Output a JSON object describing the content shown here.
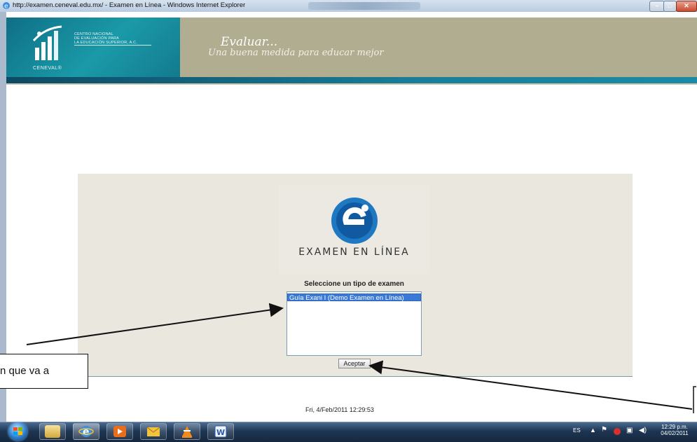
{
  "window": {
    "title": "http://examen.ceneval.edu.mx/ - Examen en Línea - Windows Internet Explorer"
  },
  "header": {
    "org_line1": "CENTRO NACIONAL",
    "org_line2": "DE EVALUACIÓN PARA",
    "org_line3": "LA EDUCACIÓN SUPERIOR, A.C.",
    "brand": "CENEVAL®",
    "tagline_title": "Evaluar...",
    "tagline_subtitle": "Una buena medida para educar mejor"
  },
  "main": {
    "logo_text": "EXAMEN EN LÍNEA",
    "select_label": "Seleccione un tipo de examen",
    "exam_options": [
      "Guía Exani I (Demo Examen en Línea)"
    ],
    "selected_option": "Guía Exani I (Demo Examen en Línea)",
    "accept_label": "Aceptar",
    "datetime": "Fri, 4/Feb/2011 12:29:53"
  },
  "callout": {
    "text": "n que va a"
  },
  "taskbar": {
    "language": "ES",
    "clock_time": "12:29 p.m.",
    "clock_date": "04/02/2011",
    "apps": [
      "windows-explorer-icon",
      "internet-explorer-icon",
      "media-player-icon",
      "outlook-icon",
      "vlc-icon",
      "word-icon"
    ]
  },
  "colors": {
    "header_teal": "#1a9aa8",
    "header_khaki": "#b1ad91",
    "panel_bg": "#e9e7de",
    "selection_blue": "#3a79d6"
  }
}
